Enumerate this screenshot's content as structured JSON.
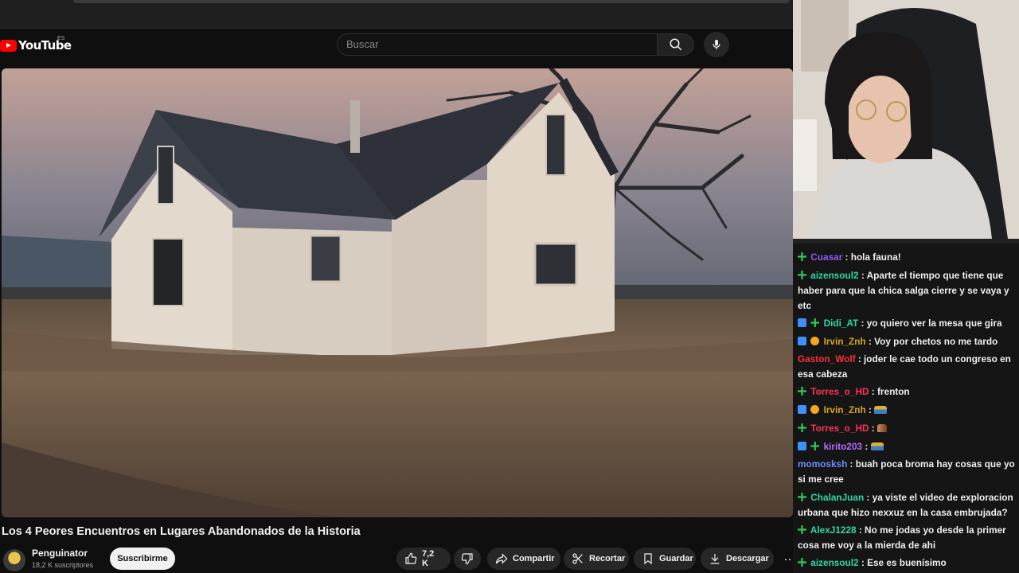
{
  "youtube": {
    "logo_text": "YouTube",
    "region": "ES",
    "search_placeholder": "Buscar"
  },
  "video": {
    "title": "Los 4 Peores Encuentros en Lugares Abandonados de la Historia",
    "channel_name": "Penguinator",
    "channel_subs": "18,2 K suscriptores",
    "subscribe_label": "Suscribirme",
    "likes": "7,2 K",
    "share_label": "Compartir",
    "clip_label": "Recortar",
    "save_label": "Guardar",
    "download_label": "Descargar",
    "more_label": "…"
  },
  "chat": {
    "messages": [
      {
        "user": "Cuasar",
        "color": "#8a5cf6",
        "text": " : hola fauna!"
      },
      {
        "user": "aizensoul2",
        "color": "#2fd8a4",
        "text": " : Aparte el tiempo que tiene que haber para que la chica salga cierre y se vaya y etc"
      },
      {
        "user": "Didi_AT",
        "color": "#2fd8a4",
        "text": " : yo quiero ver la mesa que gira"
      },
      {
        "user": "Irvin_Znh",
        "color": "#d9a520",
        "text": " : Voy por chetos no me tardo"
      },
      {
        "user": "Gaston_Wolf",
        "color": "#ff2e3a",
        "text": " : joder le cae todo un congreso en esa cabeza"
      },
      {
        "user": "Torres_o_HD",
        "color": "#ff3355",
        "text": " : frenton"
      },
      {
        "user": "Irvin_Znh",
        "color": "#d9a520",
        "text": " : "
      },
      {
        "user": "Torres_o_HD",
        "color": "#ff3355",
        "text": " : "
      },
      {
        "user": "kirito203",
        "color": "#b86cff",
        "text": " : "
      },
      {
        "user": "momosksh",
        "color": "#6e8cff",
        "text": " : buah poca broma hay cosas que yo si me cree"
      },
      {
        "user": "ChalanJuan",
        "color": "#2fd8a4",
        "text": " : ya viste el video de exploracion urbana que hizo nexxuz en la casa embrujada?"
      },
      {
        "user": "AlexJ1228",
        "color": "#2fd8a4",
        "text": " : No me jodas yo desde la primer cosa me voy a la mierda de ahi"
      },
      {
        "user": "aizensoul2",
        "color": "#2fd8a4",
        "text": " : Ese es buenísimo"
      }
    ]
  }
}
